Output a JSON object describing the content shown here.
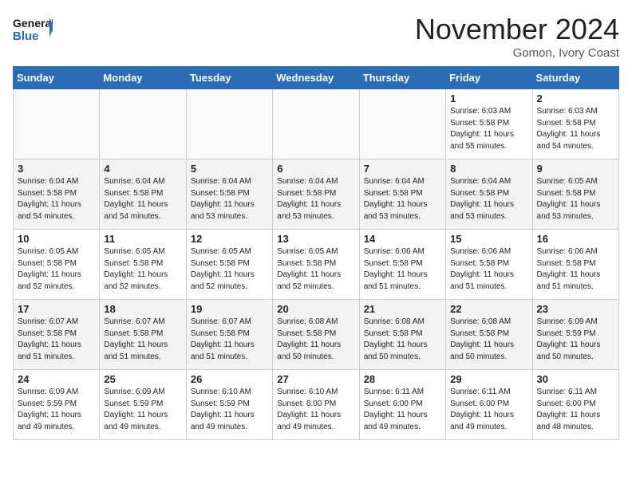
{
  "header": {
    "logo_line1": "General",
    "logo_line2": "Blue",
    "month": "November 2024",
    "location": "Gomon, Ivory Coast"
  },
  "days_of_week": [
    "Sunday",
    "Monday",
    "Tuesday",
    "Wednesday",
    "Thursday",
    "Friday",
    "Saturday"
  ],
  "weeks": [
    [
      {
        "day": "",
        "empty": true
      },
      {
        "day": "",
        "empty": true
      },
      {
        "day": "",
        "empty": true
      },
      {
        "day": "",
        "empty": true
      },
      {
        "day": "",
        "empty": true
      },
      {
        "day": "1",
        "sunrise": "6:03 AM",
        "sunset": "5:58 PM",
        "daylight": "11 hours and 55 minutes."
      },
      {
        "day": "2",
        "sunrise": "6:03 AM",
        "sunset": "5:58 PM",
        "daylight": "11 hours and 54 minutes."
      }
    ],
    [
      {
        "day": "3",
        "sunrise": "6:04 AM",
        "sunset": "5:58 PM",
        "daylight": "11 hours and 54 minutes."
      },
      {
        "day": "4",
        "sunrise": "6:04 AM",
        "sunset": "5:58 PM",
        "daylight": "11 hours and 54 minutes."
      },
      {
        "day": "5",
        "sunrise": "6:04 AM",
        "sunset": "5:58 PM",
        "daylight": "11 hours and 53 minutes."
      },
      {
        "day": "6",
        "sunrise": "6:04 AM",
        "sunset": "5:58 PM",
        "daylight": "11 hours and 53 minutes."
      },
      {
        "day": "7",
        "sunrise": "6:04 AM",
        "sunset": "5:58 PM",
        "daylight": "11 hours and 53 minutes."
      },
      {
        "day": "8",
        "sunrise": "6:04 AM",
        "sunset": "5:58 PM",
        "daylight": "11 hours and 53 minutes."
      },
      {
        "day": "9",
        "sunrise": "6:05 AM",
        "sunset": "5:58 PM",
        "daylight": "11 hours and 53 minutes."
      }
    ],
    [
      {
        "day": "10",
        "sunrise": "6:05 AM",
        "sunset": "5:58 PM",
        "daylight": "11 hours and 52 minutes."
      },
      {
        "day": "11",
        "sunrise": "6:05 AM",
        "sunset": "5:58 PM",
        "daylight": "11 hours and 52 minutes."
      },
      {
        "day": "12",
        "sunrise": "6:05 AM",
        "sunset": "5:58 PM",
        "daylight": "11 hours and 52 minutes."
      },
      {
        "day": "13",
        "sunrise": "6:05 AM",
        "sunset": "5:58 PM",
        "daylight": "11 hours and 52 minutes."
      },
      {
        "day": "14",
        "sunrise": "6:06 AM",
        "sunset": "5:58 PM",
        "daylight": "11 hours and 51 minutes."
      },
      {
        "day": "15",
        "sunrise": "6:06 AM",
        "sunset": "5:58 PM",
        "daylight": "11 hours and 51 minutes."
      },
      {
        "day": "16",
        "sunrise": "6:06 AM",
        "sunset": "5:58 PM",
        "daylight": "11 hours and 51 minutes."
      }
    ],
    [
      {
        "day": "17",
        "sunrise": "6:07 AM",
        "sunset": "5:58 PM",
        "daylight": "11 hours and 51 minutes."
      },
      {
        "day": "18",
        "sunrise": "6:07 AM",
        "sunset": "5:58 PM",
        "daylight": "11 hours and 51 minutes."
      },
      {
        "day": "19",
        "sunrise": "6:07 AM",
        "sunset": "5:58 PM",
        "daylight": "11 hours and 51 minutes."
      },
      {
        "day": "20",
        "sunrise": "6:08 AM",
        "sunset": "5:58 PM",
        "daylight": "11 hours and 50 minutes."
      },
      {
        "day": "21",
        "sunrise": "6:08 AM",
        "sunset": "5:58 PM",
        "daylight": "11 hours and 50 minutes."
      },
      {
        "day": "22",
        "sunrise": "6:08 AM",
        "sunset": "5:58 PM",
        "daylight": "11 hours and 50 minutes."
      },
      {
        "day": "23",
        "sunrise": "6:09 AM",
        "sunset": "5:59 PM",
        "daylight": "11 hours and 50 minutes."
      }
    ],
    [
      {
        "day": "24",
        "sunrise": "6:09 AM",
        "sunset": "5:59 PM",
        "daylight": "11 hours and 49 minutes."
      },
      {
        "day": "25",
        "sunrise": "6:09 AM",
        "sunset": "5:59 PM",
        "daylight": "11 hours and 49 minutes."
      },
      {
        "day": "26",
        "sunrise": "6:10 AM",
        "sunset": "5:59 PM",
        "daylight": "11 hours and 49 minutes."
      },
      {
        "day": "27",
        "sunrise": "6:10 AM",
        "sunset": "6:00 PM",
        "daylight": "11 hours and 49 minutes."
      },
      {
        "day": "28",
        "sunrise": "6:11 AM",
        "sunset": "6:00 PM",
        "daylight": "11 hours and 49 minutes."
      },
      {
        "day": "29",
        "sunrise": "6:11 AM",
        "sunset": "6:00 PM",
        "daylight": "11 hours and 49 minutes."
      },
      {
        "day": "30",
        "sunrise": "6:11 AM",
        "sunset": "6:00 PM",
        "daylight": "11 hours and 48 minutes."
      }
    ]
  ]
}
